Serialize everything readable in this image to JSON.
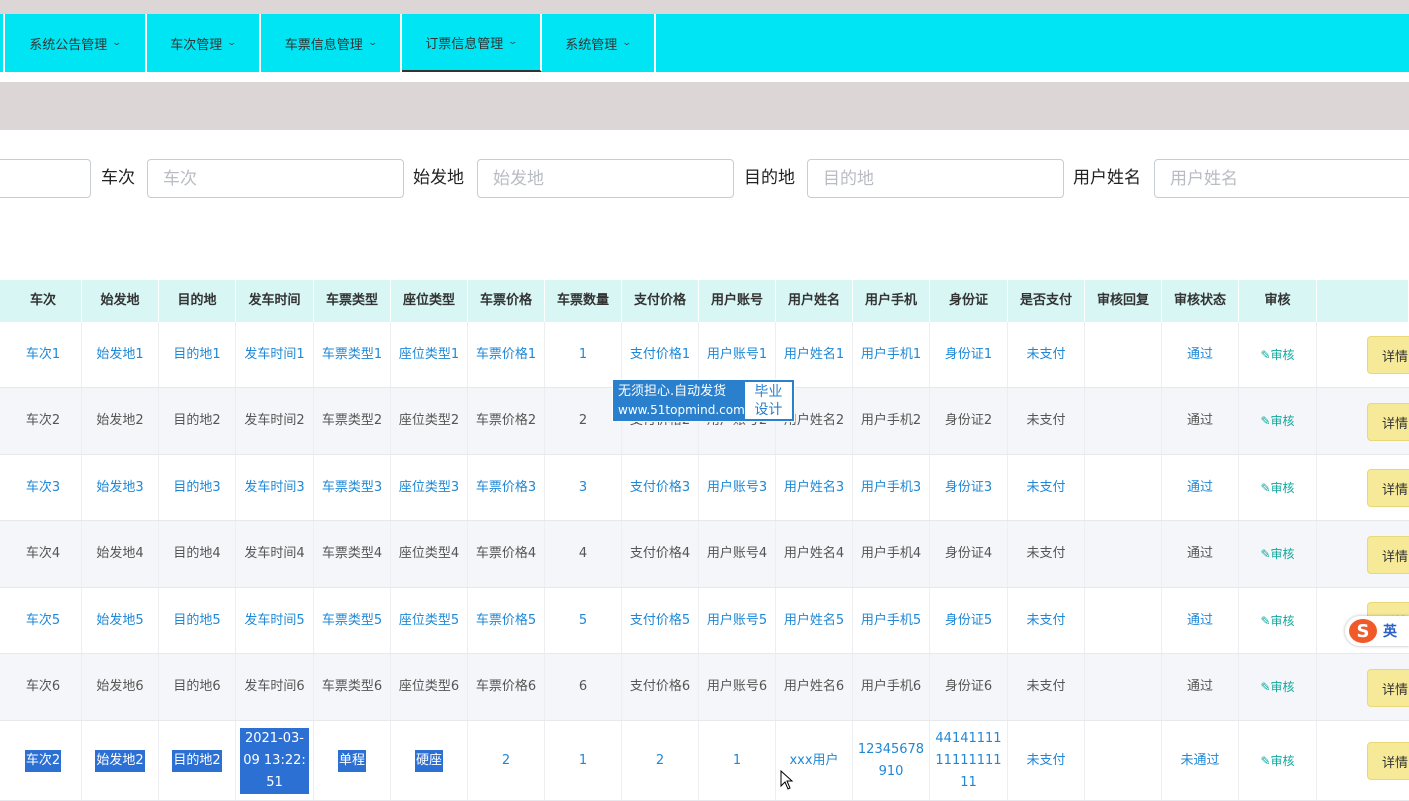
{
  "nav": {
    "items": [
      {
        "label": "系统公告管理"
      },
      {
        "label": "车次管理"
      },
      {
        "label": "车票信息管理"
      },
      {
        "label": "订票信息管理"
      },
      {
        "label": "系统管理"
      }
    ],
    "active_index": 3
  },
  "search": {
    "train_label": "车次",
    "train_placeholder": "车次",
    "origin_label": "始发地",
    "origin_placeholder": "始发地",
    "dest_label": "目的地",
    "dest_placeholder": "目的地",
    "username_label": "用户姓名",
    "username_placeholder": "用户姓名"
  },
  "table": {
    "headers": [
      "车次",
      "始发地",
      "目的地",
      "发车时间",
      "车票类型",
      "座位类型",
      "车票价格",
      "车票数量",
      "支付价格",
      "用户账号",
      "用户姓名",
      "用户手机",
      "身份证",
      "是否支付",
      "审核回复",
      "审核状态",
      "审核"
    ],
    "audit_label": "审核",
    "detail_label": "详情",
    "rows": [
      {
        "cells": [
          "车次1",
          "始发地1",
          "目的地1",
          "发车时间1",
          "车票类型1",
          "座位类型1",
          "车票价格1",
          "1",
          "支付价格1",
          "用户账号1",
          "用户姓名1",
          "用户手机1",
          "身份证1",
          "未支付",
          "",
          "通过"
        ]
      },
      {
        "cells": [
          "车次2",
          "始发地2",
          "目的地2",
          "发车时间2",
          "车票类型2",
          "座位类型2",
          "车票价格2",
          "2",
          "支付价格2",
          "用户账号2",
          "用户姓名2",
          "用户手机2",
          "身份证2",
          "未支付",
          "",
          "通过"
        ]
      },
      {
        "cells": [
          "车次3",
          "始发地3",
          "目的地3",
          "发车时间3",
          "车票类型3",
          "座位类型3",
          "车票价格3",
          "3",
          "支付价格3",
          "用户账号3",
          "用户姓名3",
          "用户手机3",
          "身份证3",
          "未支付",
          "",
          "通过"
        ]
      },
      {
        "cells": [
          "车次4",
          "始发地4",
          "目的地4",
          "发车时间4",
          "车票类型4",
          "座位类型4",
          "车票价格4",
          "4",
          "支付价格4",
          "用户账号4",
          "用户姓名4",
          "用户手机4",
          "身份证4",
          "未支付",
          "",
          "通过"
        ]
      },
      {
        "cells": [
          "车次5",
          "始发地5",
          "目的地5",
          "发车时间5",
          "车票类型5",
          "座位类型5",
          "车票价格5",
          "5",
          "支付价格5",
          "用户账号5",
          "用户姓名5",
          "用户手机5",
          "身份证5",
          "未支付",
          "",
          "通过"
        ]
      },
      {
        "cells": [
          "车次6",
          "始发地6",
          "目的地6",
          "发车时间6",
          "车票类型6",
          "座位类型6",
          "车票价格6",
          "6",
          "支付价格6",
          "用户账号6",
          "用户姓名6",
          "用户手机6",
          "身份证6",
          "未支付",
          "",
          "通过"
        ]
      },
      {
        "cells": [
          "车次2",
          "始发地2",
          "目的地2",
          "2021-03-09 13:22:51",
          "单程",
          "硬座",
          "2",
          "1",
          "2",
          "1",
          "xxx用户",
          "12345678910",
          "441411111111111111",
          "未支付",
          "",
          "未通过"
        ]
      }
    ]
  },
  "watermark": {
    "line1": "无须担心.自动发货",
    "line2": "www.51topmind.com",
    "badge1": "毕业",
    "badge2": "设计"
  },
  "ime": {
    "logo": "S",
    "mode": "英"
  },
  "colors": {
    "nav_bg": "#00e5f4",
    "header_bg": "#d7f6f4",
    "link": "#1f88d6",
    "audit": "#13a89e",
    "detail_btn": "#f6ea99"
  }
}
